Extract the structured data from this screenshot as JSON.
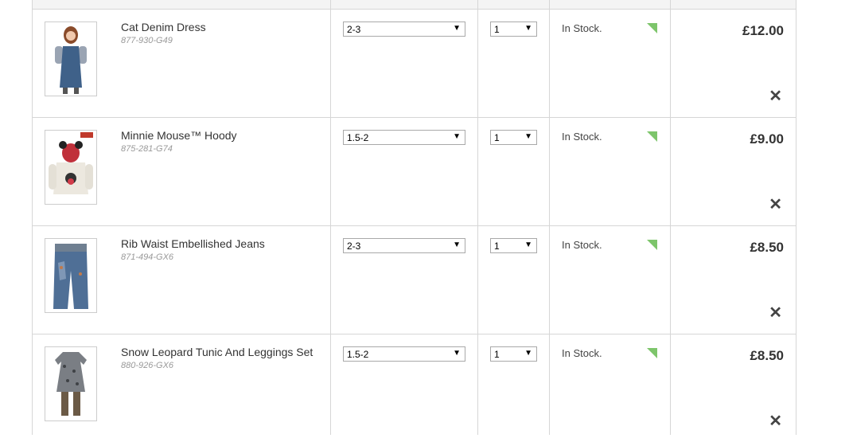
{
  "basket": {
    "items": [
      {
        "name": "Cat Denim Dress",
        "code": "877-930-G49",
        "size": "2-3",
        "qty": "1",
        "stock": "In Stock.",
        "price": "£12.00",
        "remove_icon": "close-icon",
        "thumb_icon": "dress-photo"
      },
      {
        "name": "Minnie Mouse™ Hoody",
        "code": "875-281-G74",
        "size": "1.5-2",
        "qty": "1",
        "stock": "In Stock.",
        "price": "£9.00",
        "remove_icon": "close-icon",
        "thumb_icon": "hoody-photo"
      },
      {
        "name": "Rib Waist Embellished Jeans",
        "code": "871-494-GX6",
        "size": "2-3",
        "qty": "1",
        "stock": "In Stock.",
        "price": "£8.50",
        "remove_icon": "close-icon",
        "thumb_icon": "jeans-photo"
      },
      {
        "name": "Snow Leopard Tunic And Leggings Set",
        "code": "880-926-GX6",
        "size": "1.5-2",
        "qty": "1",
        "stock": "In Stock.",
        "price": "£8.50",
        "remove_icon": "close-icon",
        "thumb_icon": "tunic-photo"
      }
    ],
    "remove_glyph": "✕",
    "dropdown_arrow": "▼",
    "colors": {
      "stock_flag": "#7dc56b",
      "border": "#d6d6d6",
      "header": "#f4f4f4"
    }
  }
}
